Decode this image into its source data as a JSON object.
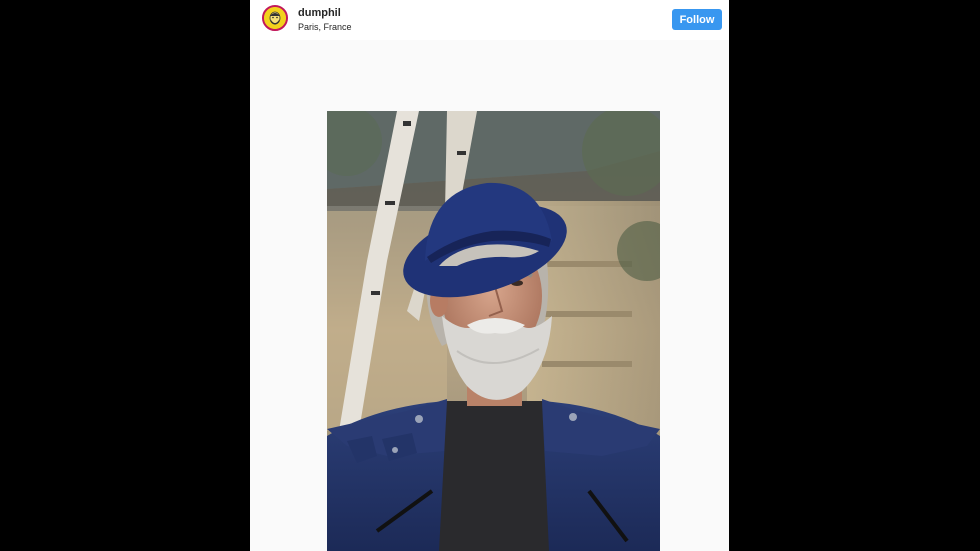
{
  "post": {
    "username": "dumphil",
    "location": "Paris, France",
    "follow_label": "Follow"
  },
  "colors": {
    "follow_button": "#3897f0",
    "avatar_ring": "#c2185b",
    "avatar_fill": "#f2d21c"
  },
  "icons": {
    "avatar": "profile-avatar"
  },
  "media": {
    "subject": "photo-man-grey-beard-blue-hat"
  }
}
